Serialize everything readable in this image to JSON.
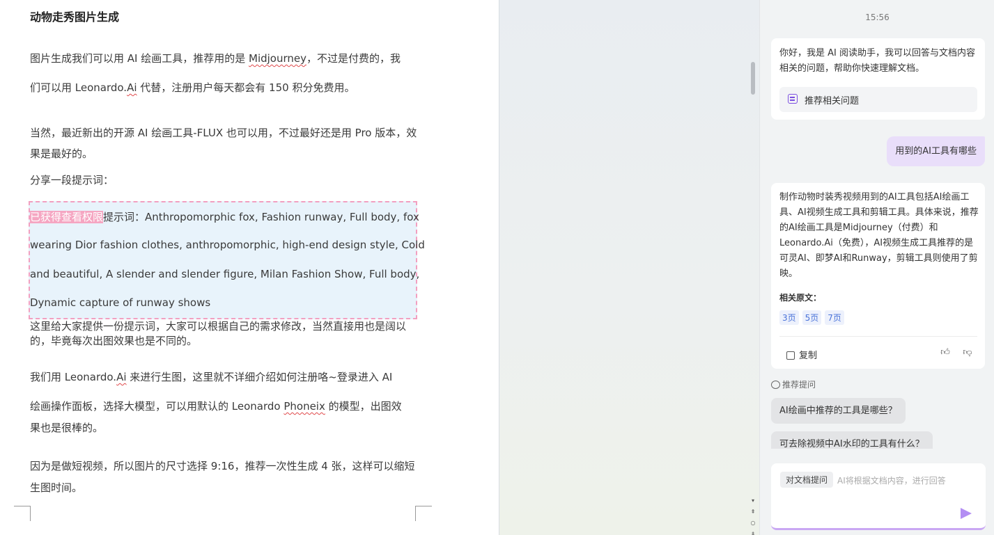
{
  "doc": {
    "title": "动物走秀图片生成",
    "p1a": "图片生成我们可以用 AI 绘画工具，推荐用的是 ",
    "p1_link": "Midjourney",
    "p1b": "，不过是付费的，我",
    "p2a": "们可以用 Leonardo.",
    "p2_link": "Ai",
    "p2b": " 代替，注册用户每天都会有 150 积分免费用。",
    "p3": "当然，最近新出的开源 AI 绘画工具-FLUX 也可以用，不过最好还是用 Pro 版本，效果是最好的。",
    "p4": "分享一段提示词：",
    "locked_label": "已获得查看权限",
    "prompt_lines": [
      "提示词：Anthropomorphic fox, Fashion runway, Full body, fox",
      "wearing Dior fashion clothes, anthropomorphic, high-end design style, Cold",
      "and beautiful, A slender and slender figure, Milan Fashion Show, Full body,",
      "Dynamic capture of runway shows"
    ],
    "p5": "这里给大家提供一份提示词，大家可以根据自己的需求修改，当然直接用也是阔以的，毕竟每次出图效果也是不同的。",
    "p6a": "我们用 Leonardo.",
    "p6_link": "Ai",
    "p6b": " 来进行生图，这里就不详细介绍如何注册咯~登录进入 AI",
    "p7a": "绘画操作面板，选择大模型，可以用默认的 Leonardo ",
    "p7_link": "Phoneix",
    "p7b": " 的模型，出图效",
    "p7c": "果也是很棒的。",
    "p8": "因为是做短视频，所以图片的尺寸选择 9:16，推荐一次性生成 4 张，这样可以缩短生图时间。"
  },
  "panel": {
    "time": "15:56",
    "welcome": "你好，我是 AI 阅读助手，我可以回答与文档内容相关的问题，帮助你快速理解文档。",
    "recommend_button": "推荐相关问题",
    "user_question": "用到的AI工具有哪些",
    "answer": "制作动物时装秀视频用到的AI工具包括AI绘画工具、AI视频生成工具和剪辑工具。具体来说，推荐的AI绘画工具是Midjourney（付费）和Leonardo.Ai（免费），AI视频生成工具推荐的是可灵AI、即梦AI和Runway，剪辑工具则使用了剪映。",
    "related_label": "相关原文：",
    "related_pages": [
      "3页",
      "5页",
      "7页"
    ],
    "copy_label": "复制",
    "suggest_label": "推荐提问",
    "suggestions": [
      "AI绘画中推荐的工具是哪些？",
      "可去除视频中AI水印的工具有什么？"
    ],
    "input_mode": "对文档提问",
    "input_placeholder": "AI将根据文档内容，进行回答"
  }
}
